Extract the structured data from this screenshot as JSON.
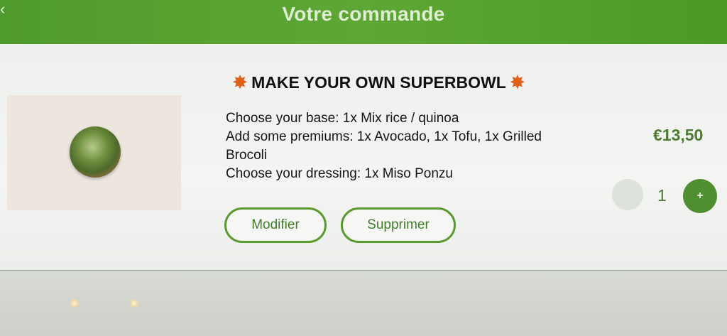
{
  "header": {
    "title": "Votre commande",
    "back_icon": "back-arrow-icon",
    "color": "#5ea735"
  },
  "item": {
    "title": "MAKE YOUR OWN SUPERBOWL",
    "title_icon": "burst-icon",
    "options": [
      "Choose your base: 1x Mix rice / quinoa",
      "Add some premiums: 1x Avocado, 1x Tofu, 1x Grilled",
      "Brocoli",
      "Choose your dressing: 1x Miso Ponzu"
    ],
    "price": "€13,50",
    "quantity": "1",
    "plus_label": "+",
    "modify_label": "Modifier",
    "delete_label": "Supprimer",
    "accent_color": "#4f8f2f"
  }
}
